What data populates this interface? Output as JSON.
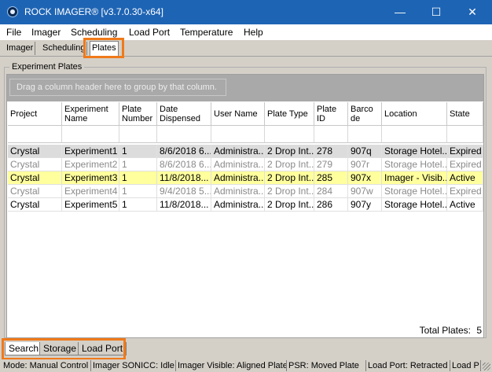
{
  "window": {
    "title": "ROCK IMAGER® [v3.7.0.30-x64]",
    "minimize_glyph": "—",
    "maximize_glyph": "☐",
    "close_glyph": "✕"
  },
  "menu": [
    "File",
    "Imager",
    "Scheduling",
    "Load Port",
    "Temperature",
    "Help"
  ],
  "top_tabs": [
    "Imager",
    "Scheduling",
    "Plates"
  ],
  "groupbox_label": "Experiment Plates",
  "groupby_hint": "Drag a column header here to group by that column.",
  "columns": [
    "Project",
    "Experiment Name",
    "Plate Number",
    "Date Dispensed",
    "User Name",
    "Plate Type",
    "Plate ID",
    "Barco de",
    "Location",
    "State"
  ],
  "rows": [
    [
      "Crystal",
      "Experiment1",
      "1",
      "8/6/2018  6...",
      "Administra...",
      "2 Drop Int...",
      "278",
      "907q",
      "Storage  Hotel...",
      "Expired"
    ],
    [
      "Crystal",
      "Experiment2",
      "1",
      "8/6/2018  6...",
      "Administra...",
      "2 Drop Int...",
      "279",
      "907r",
      "Storage  Hotel...",
      "Expired"
    ],
    [
      "Crystal",
      "Experiment3",
      "1",
      "11/8/2018...",
      "Administra...",
      "2 Drop Int...",
      "285",
      "907x",
      "Imager - Visib...",
      "Active"
    ],
    [
      "Crystal",
      "Experiment4",
      "1",
      "9/4/2018  5...",
      "Administra...",
      "2 Drop Int...",
      "284",
      "907w",
      "Storage  Hotel...",
      "Expired"
    ],
    [
      "Crystal",
      "Experiment5",
      "1",
      "11/8/2018...",
      "Administra...",
      "2 Drop Int...",
      "286",
      "907y",
      "Storage  Hotel...",
      "Active"
    ]
  ],
  "total_label": "Total Plates:",
  "total_value": "5",
  "bottom_tabs": [
    "Search",
    "Storage",
    "Load Port"
  ],
  "status": [
    "Mode: Manual Control",
    "Imager SONICC: Idle",
    "Imager Visible: Aligned Plate",
    "PSR: Moved Plate",
    "Load Port: Retracted",
    "Load P"
  ],
  "colors": {
    "titlebar": "#1e64b4",
    "highlight": "#f07a1a",
    "selected_row": "#ffff9e",
    "first_row": "#dcdcdc",
    "dim_text": "#8a8a8a"
  }
}
